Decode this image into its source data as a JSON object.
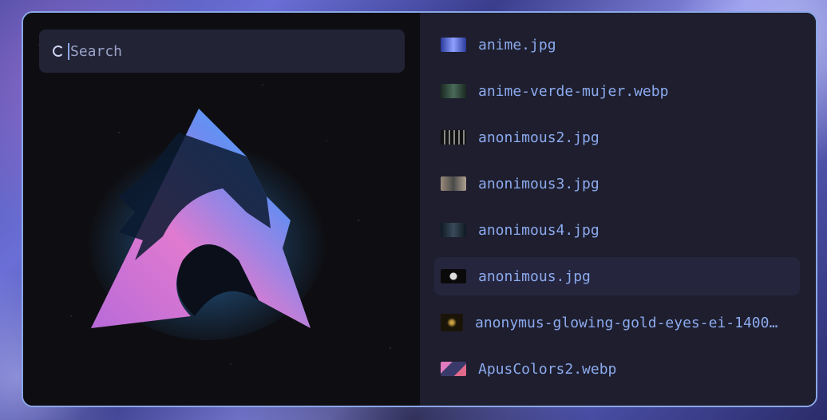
{
  "search": {
    "placeholder": "Search",
    "value": ""
  },
  "files": [
    {
      "name": "anime.jpg",
      "thumb_color": "#3a52c4",
      "selected": false
    },
    {
      "name": "anime-verde-mujer.webp",
      "thumb_color": "#2a3a32",
      "selected": false
    },
    {
      "name": "anonimous2.jpg",
      "thumb_color": "#1a1a1a",
      "selected": false
    },
    {
      "name": "anonimous3.jpg",
      "thumb_color": "#6b6b6b",
      "selected": false
    },
    {
      "name": "anonimous4.jpg",
      "thumb_color": "#18242a",
      "selected": false
    },
    {
      "name": "anonimous.jpg",
      "thumb_color": "#0d0d0d",
      "selected": true
    },
    {
      "name": "anonymus-glowing-gold-eyes-ei-1400…",
      "thumb_color": "#3a3020",
      "selected": false
    },
    {
      "name": "ApusColors2.webp",
      "thumb_color": "#4a4a8a",
      "selected": false
    }
  ],
  "colors": {
    "border": "#8aa6e6",
    "text": "#8caaee",
    "selected_bg": "#25253e",
    "panel_bg": "#1e1e2e"
  }
}
